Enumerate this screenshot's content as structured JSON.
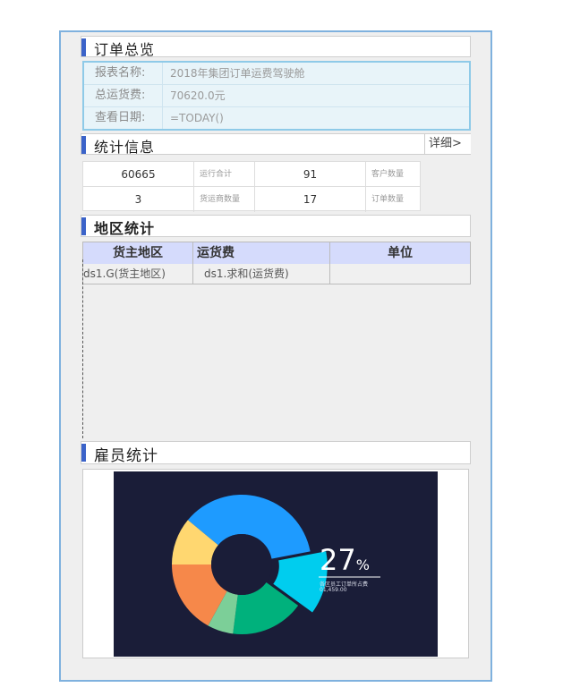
{
  "sections": {
    "order_overview": "订单总览",
    "stats_info": "统计信息",
    "region_stats": "地区统计",
    "employee_stats": "雇员统计"
  },
  "info": {
    "rows": [
      {
        "label": "报表名称:",
        "value": "2018年集团订单运费驾驶舱"
      },
      {
        "label": "总运货费:",
        "value": "70620.0元"
      },
      {
        "label": "查看日期:",
        "value": "=TODAY()"
      }
    ]
  },
  "detail_link": "详细>",
  "stats": {
    "row1": [
      {
        "value": "60665",
        "label": "运行合计"
      },
      {
        "value": "91",
        "label": "客户数量"
      }
    ],
    "row2": [
      {
        "value": "3",
        "label": "货运商数量"
      },
      {
        "value": "17",
        "label": "订单数量"
      }
    ]
  },
  "region_table": {
    "headers": [
      "货主地区",
      "运货费",
      "单位"
    ],
    "row": [
      "ds1.G(货主地区)",
      "ds1.求和(运货费)",
      ""
    ]
  },
  "donut": {
    "percent": "27",
    "percent_sign": "%",
    "caption1": "各区员工订单所占费",
    "caption2": "01,459.00",
    "colors": [
      "#1e9bff",
      "#00cdee",
      "#00b17c",
      "#7ccf98",
      "#f6884a",
      "#ffd770"
    ],
    "slices": [
      0.36,
      0.13,
      0.17,
      0.06,
      0.17,
      0.11
    ]
  }
}
